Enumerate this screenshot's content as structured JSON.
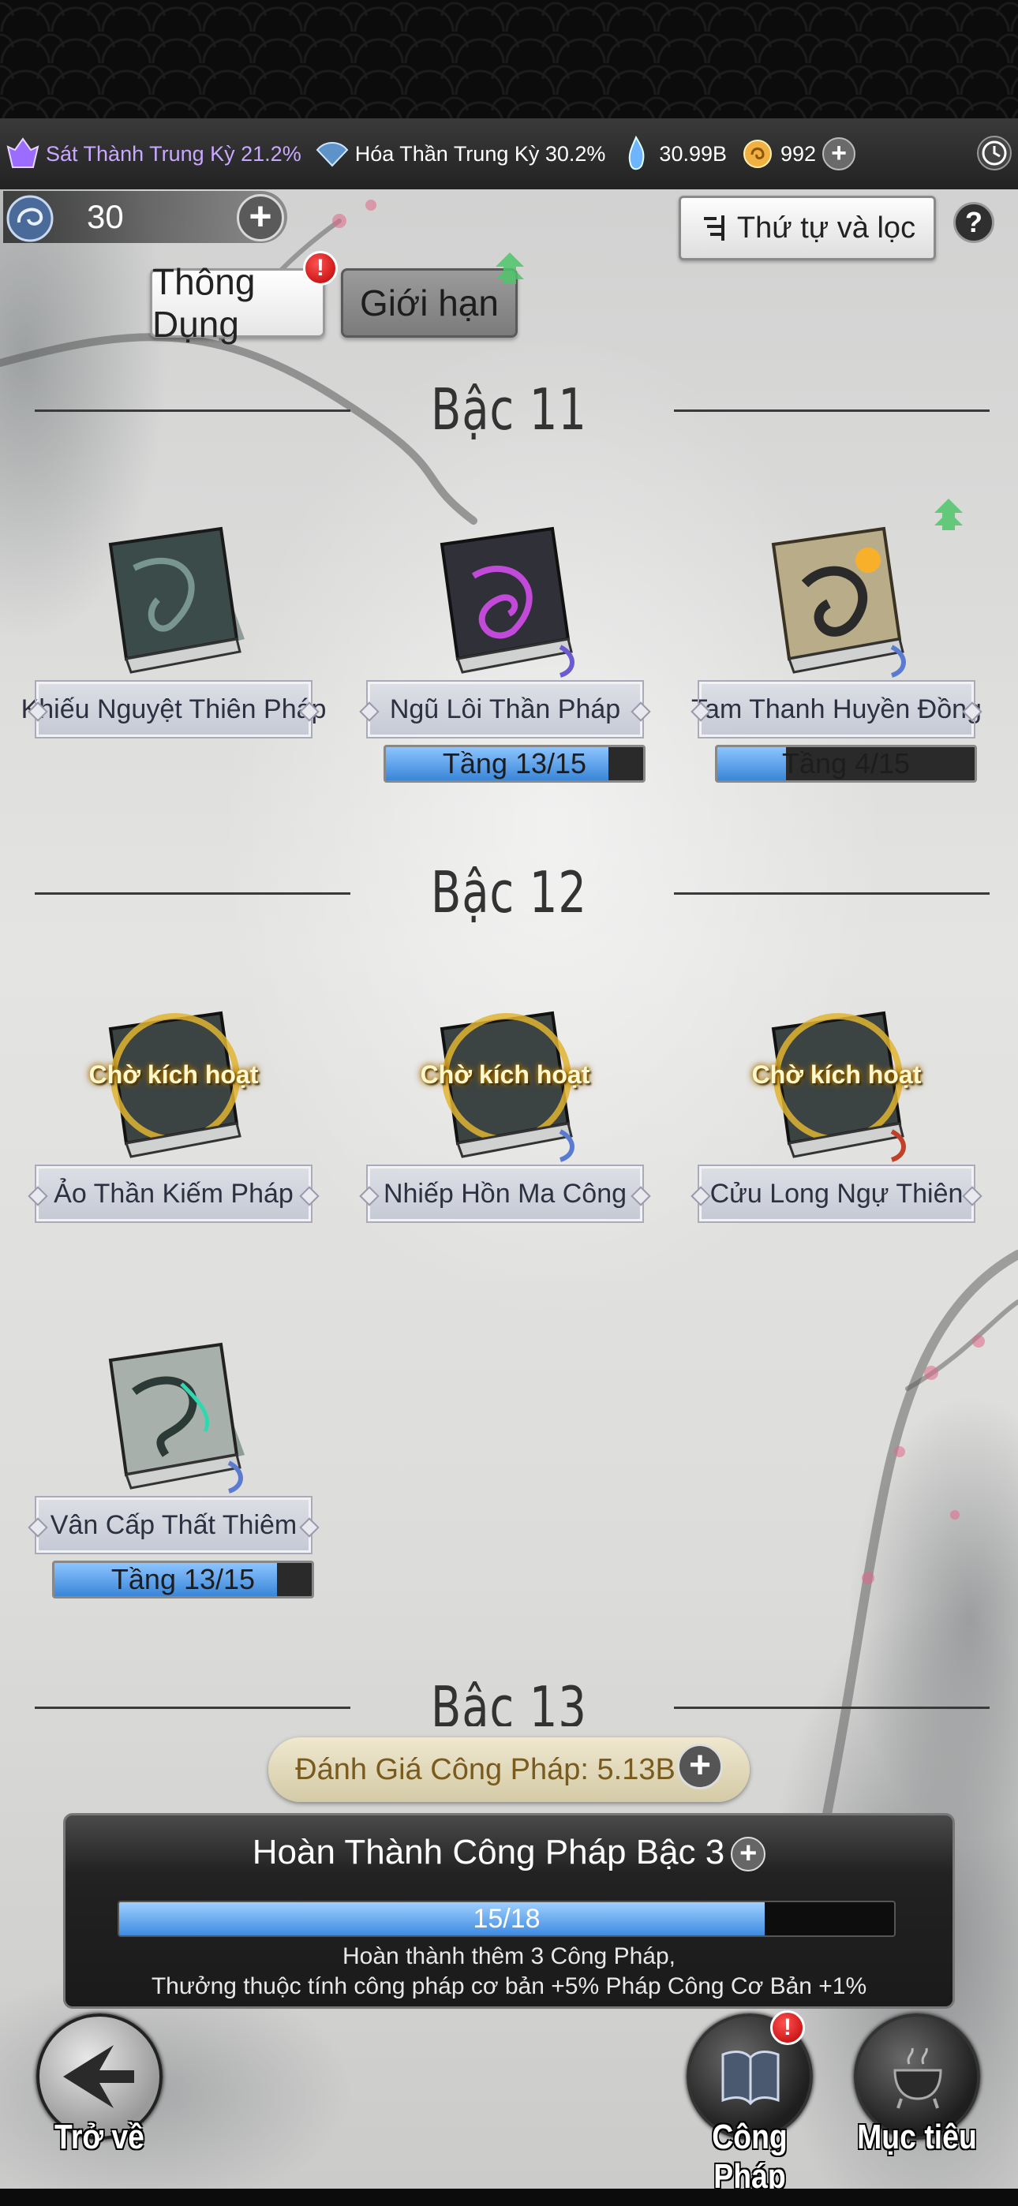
{
  "resources": {
    "realm1": "Sát Thành Trung Kỳ 21.2%",
    "realm2": "Hóa Thần Trung Kỳ 30.2%",
    "spirit_stones": "30.99B",
    "coins": "992"
  },
  "jade": {
    "value": "30"
  },
  "filter_label": "Thứ tự và lọc",
  "help_label": "?",
  "tabs": [
    {
      "label": "Thông Dụng",
      "badge": "!"
    },
    {
      "label": "Giới hạn"
    }
  ],
  "tiers": [
    {
      "title": "Bậc 11",
      "items": [
        {
          "name": "Khiếu Nguyệt Thiên Pháp"
        },
        {
          "name": "Ngũ Lôi Thần Pháp",
          "progress": "Tầng 13/15",
          "fraction": 0.866
        },
        {
          "name": "Tam Thanh Huyền Đồng",
          "progress": "Tầng 4/15",
          "fraction": 0.266
        }
      ]
    },
    {
      "title": "Bậc 12",
      "items": [
        {
          "name": "Ảo Thần Kiếm Pháp",
          "status": "Chờ kích hoạt"
        },
        {
          "name": "Nhiếp Hồn Ma Công",
          "status": "Chờ kích hoạt"
        },
        {
          "name": "Cửu Long Ngự Thiên",
          "status": "Chờ kích hoạt"
        },
        {
          "name": "Vân Cấp Thất Thiêm",
          "progress": "Tầng 13/15",
          "fraction": 0.866
        }
      ]
    },
    {
      "title": "Bậc 13"
    }
  ],
  "rating": {
    "label": "Đánh Giá Công Pháp: 5.13B"
  },
  "quest": {
    "title": "Hoàn Thành Công Pháp Bậc 3",
    "progress_label": "15/18",
    "fraction": 0.833,
    "desc1": "Hoàn thành thêm 3 Công Pháp,",
    "desc2": "Thưởng thuộc tính công pháp cơ bản +5% Pháp Công Cơ Bản +1%"
  },
  "nav": {
    "back": "Trở về",
    "technique": "Công Pháp",
    "technique_badge": "!",
    "goal": "Mục tiêu"
  },
  "colors": {
    "progress_fill": "#3a86d8",
    "badge": "#d40000",
    "realm1_text": "#c9a8ff",
    "rating_text": "#7a5b1e"
  },
  "icons": [
    "realm-icon",
    "fan-icon",
    "spirit-stone-icon",
    "coin-icon",
    "plus-icon",
    "clock-icon",
    "jade-icon",
    "filter-icon",
    "help-icon",
    "alert-icon",
    "upgrade-arrow-icon",
    "book-icon",
    "back-arrow-icon",
    "goal-cauldron-icon"
  ]
}
